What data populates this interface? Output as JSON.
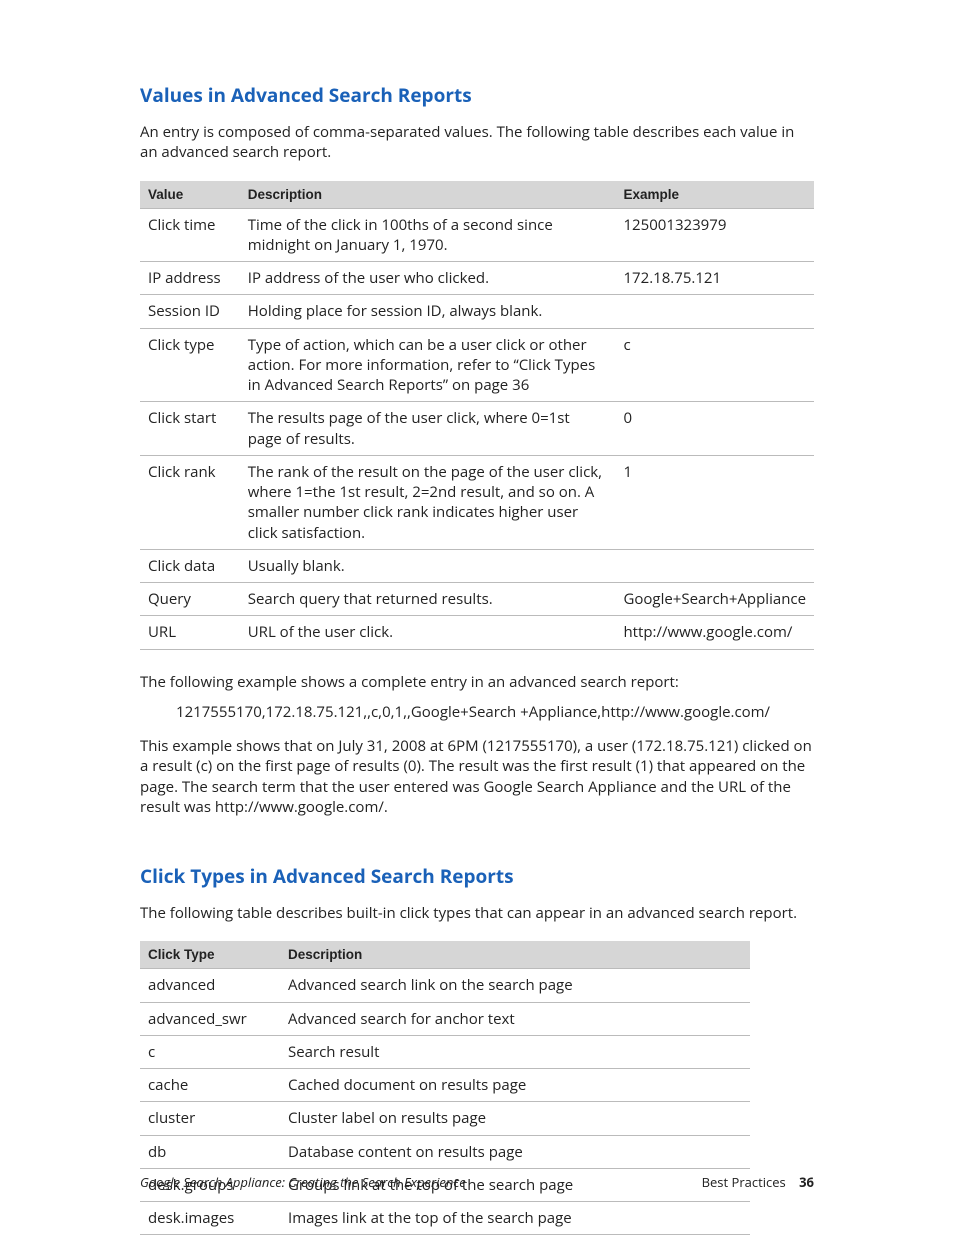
{
  "section1": {
    "heading": "Values in Advanced Search Reports",
    "intro": "An entry is composed of comma-separated values. The following table describes each value in an advanced search report.",
    "table": {
      "headers": {
        "value": "Value",
        "description": "Description",
        "example": "Example"
      },
      "rows": [
        {
          "value": "Click time",
          "description": "Time of the click in 100ths of a second since midnight on January 1, 1970.",
          "example": "125001323979"
        },
        {
          "value": "IP address",
          "description": "IP address of the user who clicked.",
          "example": "172.18.75.121"
        },
        {
          "value": "Session ID",
          "description": "Holding place for session ID, always blank.",
          "example": ""
        },
        {
          "value": "Click type",
          "description": "Type of action, which can be a user click or other action. For more information, refer to “Click Types in Advanced Search Reports” on page 36",
          "example": "c"
        },
        {
          "value": "Click start",
          "description": "The results page of the user click, where 0=1st page of results.",
          "example": "0"
        },
        {
          "value": "Click rank",
          "description": "The rank of the result on the page of the user click, where 1=the 1st result, 2=2nd result, and so on. A smaller number click rank indicates higher user click satisfaction.",
          "example": "1"
        },
        {
          "value": "Click data",
          "description": "Usually blank.",
          "example": ""
        },
        {
          "value": "Query",
          "description": "Search query that returned results.",
          "example": "Google+Search+Appliance"
        },
        {
          "value": "URL",
          "description": "URL of the user click.",
          "example": "http://www.google.com/"
        }
      ]
    },
    "example_intro": "The following example shows a complete entry in an advanced search report:",
    "example_line": "1217555170,172.18.75.121,,c,0,1,,Google+Search +Appliance,http://www.google.com/",
    "example_explain": "This example shows that on July 31, 2008 at 6PM (1217555170), a user (172.18.75.121) clicked on a result (c) on the first page of results (0). The result was the first result (1) that appeared on the page. The search term that the user entered was Google Search Appliance and the URL of the result was http://www.google.com/."
  },
  "section2": {
    "heading": "Click Types in Advanced Search Reports",
    "intro": "The following table describes built-in click types that can appear in an advanced search report.",
    "table": {
      "headers": {
        "type": "Click Type",
        "description": "Description"
      },
      "rows": [
        {
          "type": "advanced",
          "description": "Advanced search link on the search page"
        },
        {
          "type": "advanced_swr",
          "description": "Advanced search for anchor text"
        },
        {
          "type": "c",
          "description": "Search result"
        },
        {
          "type": "cache",
          "description": "Cached document on results page"
        },
        {
          "type": "cluster",
          "description": "Cluster label on results page"
        },
        {
          "type": "db",
          "description": "Database content on results page"
        },
        {
          "type": "desk.groups",
          "description": "Groups link at the top of the search page"
        },
        {
          "type": "desk.images",
          "description": "Images link at the top of the search page"
        }
      ]
    }
  },
  "footer": {
    "left": "Google Search Appliance: Creating the Search Experience",
    "right_label": "Best Practices",
    "page_number": "36"
  }
}
